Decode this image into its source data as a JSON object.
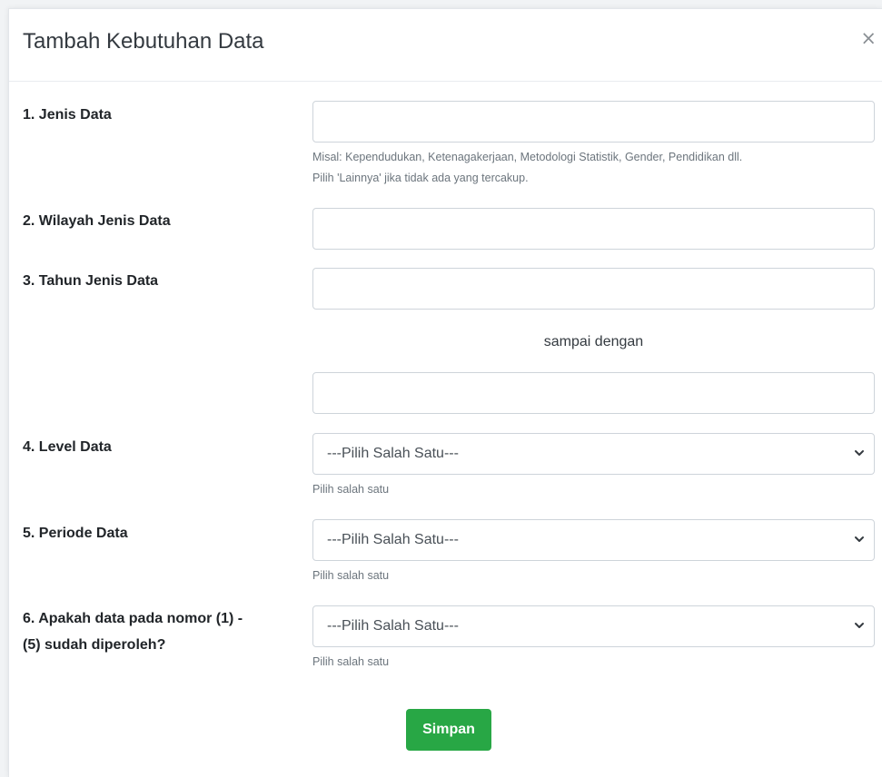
{
  "modal": {
    "title": "Tambah Kebutuhan Data",
    "close_symbol": "×"
  },
  "form": {
    "jenis_data": {
      "label": "1. Jenis Data",
      "value": "",
      "help_line1": "Misal: Kependudukan, Ketenagakerjaan, Metodologi Statistik, Gender, Pendidikan dll.",
      "help_line2": "Pilih 'Lainnya' jika tidak ada yang tercakup."
    },
    "wilayah": {
      "label": "2. Wilayah Jenis Data",
      "value": ""
    },
    "tahun": {
      "label": "3. Tahun Jenis Data",
      "start_value": "",
      "between_text": "sampai dengan",
      "end_value": ""
    },
    "level": {
      "label": "4. Level Data",
      "selected": "---Pilih Salah Satu---",
      "help": "Pilih salah satu"
    },
    "periode": {
      "label": "5. Periode Data",
      "selected": "---Pilih Salah Satu---",
      "help": "Pilih salah satu"
    },
    "diperoleh": {
      "label_line1": "6. Apakah data pada nomor (1) -",
      "label_line2": "(5) sudah diperoleh?",
      "selected": "---Pilih Salah Satu---",
      "help": "Pilih salah satu"
    },
    "submit_label": "Simpan"
  },
  "colors": {
    "submit": "#28a745",
    "border": "#ced4da",
    "help_text": "#6c757d"
  },
  "icons": {
    "close": "close-icon",
    "select": "chevron-down-icon"
  }
}
